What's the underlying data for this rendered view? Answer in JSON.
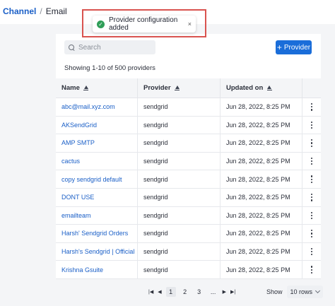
{
  "breadcrumb": {
    "parent": "Channel",
    "separator": "/",
    "current": "Email"
  },
  "toast": {
    "message": "Provider configuration added",
    "close": "×"
  },
  "toolbar": {
    "search_placeholder": "Search",
    "add_label": "Provider",
    "add_icon": "+"
  },
  "summary": "Showing 1-10 of 500 providers",
  "table": {
    "columns": [
      "Name",
      "Provider",
      "Updated on"
    ],
    "rows": [
      {
        "name": "abc@mail.xyz.com",
        "provider": "sendgrid",
        "updated": "Jun 28, 2022, 8:25 PM"
      },
      {
        "name": "AKSendGrid",
        "provider": "sendgrid",
        "updated": "Jun 28, 2022, 8:25 PM"
      },
      {
        "name": "AMP SMTP",
        "provider": "sendgrid",
        "updated": "Jun 28, 2022, 8:25 PM"
      },
      {
        "name": "cactus",
        "provider": "sendgrid",
        "updated": "Jun 28, 2022, 8:25 PM"
      },
      {
        "name": "copy sendgrid default",
        "provider": "sendgrid",
        "updated": "Jun 28, 2022, 8:25 PM"
      },
      {
        "name": "DONT USE",
        "provider": "sendgrid",
        "updated": "Jun 28, 2022, 8:25 PM"
      },
      {
        "name": "emailteam",
        "provider": "sendgrid",
        "updated": "Jun 28, 2022, 8:25 PM"
      },
      {
        "name": "Harsh' Sendgrid Orders",
        "provider": "sendgrid",
        "updated": "Jun 28, 2022, 8:25 PM"
      },
      {
        "name": "Harsh's Sendgrid | Official",
        "provider": "sendgrid",
        "updated": "Jun 28, 2022, 8:25 PM"
      },
      {
        "name": "Krishna Gsuite",
        "provider": "sendgrid",
        "updated": "Jun 28, 2022, 8:25 PM"
      }
    ]
  },
  "pagination": {
    "pages": [
      "1",
      "2",
      "3"
    ],
    "ellipsis": "...",
    "current": "1"
  },
  "page_size": {
    "label": "Show",
    "value": "10 rows"
  },
  "colors": {
    "accent": "#1a6dd9",
    "link": "#1a5fc7",
    "success": "#2f9e58",
    "highlight": "#d9534f",
    "surface": "#f4f5f7"
  },
  "icons": [
    "search-icon",
    "check-circle-icon",
    "close-icon",
    "sort-up-icon",
    "kebab-icon",
    "first-page-icon",
    "prev-page-icon",
    "next-page-icon",
    "last-page-icon",
    "chevron-down-icon"
  ]
}
